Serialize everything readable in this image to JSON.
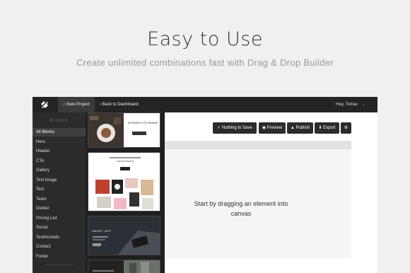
{
  "hero": {
    "title": "Easy to Use",
    "subtitle": "Create unlimited combinations fast with Drag & Drop Builder"
  },
  "topbar": {
    "new_project": "New Project",
    "back": "Back to Dashboard",
    "user": "Hey, Tomas"
  },
  "sidebar": {
    "heading": "BLOCKS",
    "items": [
      "All Blocks",
      "Hero",
      "Header",
      "CTA",
      "Gallery",
      "Text Image",
      "Text",
      "Team",
      "Divider",
      "Pricing List",
      "Social",
      "Testimonials",
      "Contact",
      "Footer"
    ]
  },
  "thumbs": {
    "t1_title": "DESIGNED FOR HUMANS",
    "t3_title": "SMART APP"
  },
  "toolbar": {
    "save": "Nothing to Save",
    "preview": "Preview",
    "publish": "Publish",
    "export": "Export"
  },
  "canvas": {
    "line1": "Start by dragging an element into",
    "line2": "canvas"
  },
  "colors": {
    "topbar": "#242424",
    "sidebar": "#2b2b2b",
    "background": "#f0f0f0"
  }
}
